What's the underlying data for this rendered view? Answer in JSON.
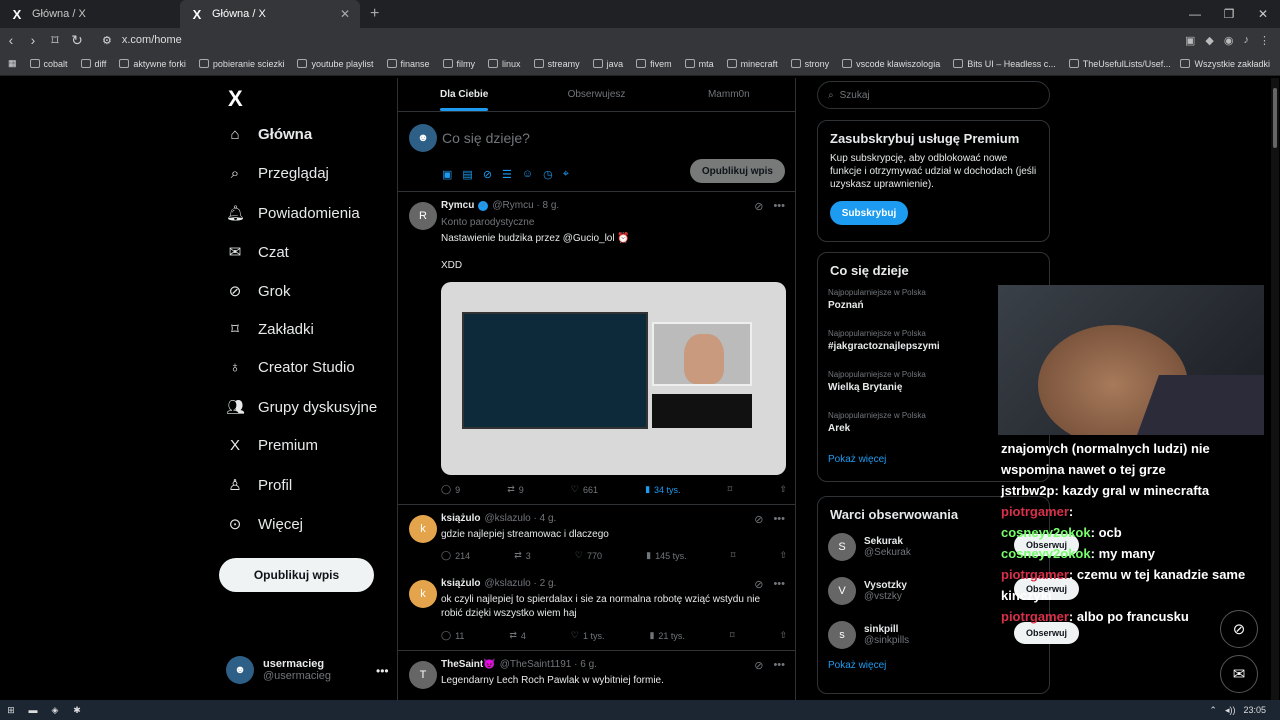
{
  "browser": {
    "tabs": [
      {
        "label": "Główna / X"
      },
      {
        "label": "Główna / X"
      }
    ],
    "url": "x.com/home"
  },
  "bookmarks": [
    "cobalt",
    "diff",
    "aktywne forki",
    "pobieranie sciezki",
    "youtube playlist",
    "finanse",
    "filmy",
    "linux",
    "streamy",
    "java",
    "fivem",
    "mta",
    "minecraft",
    "strony",
    "vscode klawiszologia",
    "Bits UI – Headless c...",
    "TheUsefulLists/Usef...",
    "Wszystkie zakładki"
  ],
  "sidebar": {
    "items": [
      "Główna",
      "Przeglądaj",
      "Powiadomienia",
      "Czat",
      "Grok",
      "Zakładki",
      "Creator Studio",
      "Grupy dyskusyjne",
      "Premium",
      "Profil",
      "Więcej"
    ],
    "post_button": "Opublikuj wpis",
    "user": {
      "name": "usermacieg",
      "handle": "@usermacieg"
    }
  },
  "feed": {
    "tabs": [
      "Dla Ciebie",
      "Obserwujesz",
      "Mamm0n"
    ],
    "compose_placeholder": "Co się dzieje?",
    "compose_button": "Opublikuj wpis",
    "tweets": [
      {
        "name": "Rymcu",
        "handle": "@Rymcu · 8 g.",
        "badge": "Konto parodystyczne",
        "text": "Nastawienie budzika przez @Gucio_lol ⏰",
        "text2": "XDD",
        "replies": "9",
        "retweets": "9",
        "likes": "661",
        "views": "34 tys."
      },
      {
        "name": "książulo",
        "handle": "@kslazulo · 4 g.",
        "text": "gdzie najlepiej streamowac i dlaczego",
        "replies": "214",
        "retweets": "3",
        "likes": "770",
        "views": "145 tys."
      },
      {
        "name": "książulo",
        "handle": "@kslazulo · 2 g.",
        "text": "ok czyli najlepiej to spierdalax i sie za normalna robotę wziąć wstydu nie robić dzięki wszystko wiem haj",
        "replies": "11",
        "retweets": "4",
        "likes": "1 tys.",
        "views": "21 tys."
      },
      {
        "name": "TheSaint😈",
        "handle": "@TheSaint1191 · 6 g.",
        "text": "Legendarny Lech Roch Pawlak w wybitniej formie."
      }
    ]
  },
  "search": {
    "placeholder": "Szukaj"
  },
  "premium": {
    "title": "Zasubskrybuj usługę Premium",
    "text": "Kup subskrypcję, aby odblokować nowe funkcje i otrzymywać udział w dochodach (jeśli uzyskasz uprawnienie).",
    "button": "Subskrybuj"
  },
  "trends": {
    "title": "Co się dzieje",
    "items": [
      {
        "cat": "Najpopularniejsze w Polska",
        "name": "Poznań"
      },
      {
        "cat": "Najpopularniejsze w Polska",
        "name": "#jakgractoznajlepszymi"
      },
      {
        "cat": "Najpopularniejsze w Polska",
        "name": "Wielką Brytanię"
      },
      {
        "cat": "Najpopularniejsze w Polska",
        "name": "Arek"
      }
    ],
    "more": "Pokaż więcej"
  },
  "who": {
    "title": "Warci obserwowania",
    "items": [
      {
        "name": "Sekurak",
        "handle": "@Sekurak"
      },
      {
        "name": "Vysotzky",
        "handle": "@vstzky"
      },
      {
        "name": "sinkpill",
        "handle": "@sinkpills"
      }
    ],
    "follow": "Obserwuj",
    "more": "Pokaż więcej"
  },
  "chat": [
    {
      "user": "jstrbw2p",
      "text": "znajomych (normalnych ludzi) nie wspomina nawet o tej grze"
    },
    {
      "user": "jstrbw2p",
      "text": "kazdy gral w minecrafta"
    },
    {
      "user": "piotrgamer",
      "text": ""
    },
    {
      "user": "cosneyv2okok",
      "text": "ocb"
    },
    {
      "user": "cosneyv2okok",
      "text": "my many"
    },
    {
      "user": "piotrgamer",
      "text": "czemu w tej kanadzie same kińczyki"
    },
    {
      "user": "piotrgamer",
      "text": "albo po francusku"
    }
  ],
  "clock": "23:05"
}
